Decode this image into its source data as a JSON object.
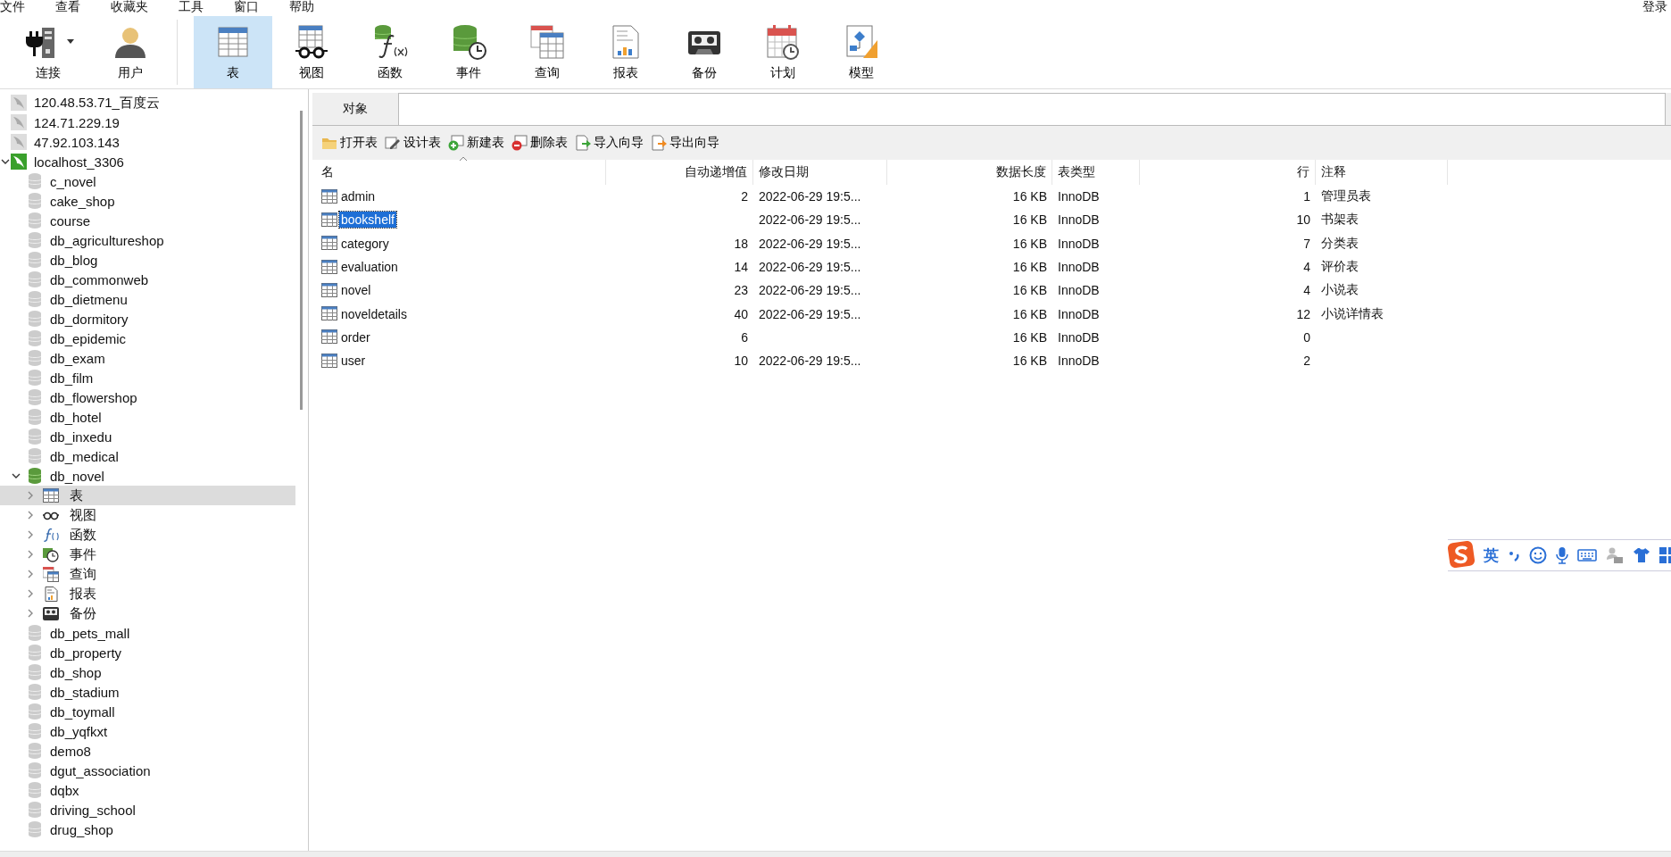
{
  "menu": [
    "文件",
    "查看",
    "收藏夹",
    "工具",
    "窗口",
    "帮助"
  ],
  "account": "登录",
  "toolbar": [
    {
      "label": "连接",
      "selected": false,
      "dropdown": true
    },
    {
      "label": "用户",
      "selected": false
    },
    {
      "label": "表",
      "selected": true
    },
    {
      "label": "视图",
      "selected": false
    },
    {
      "label": "函数",
      "selected": false
    },
    {
      "label": "事件",
      "selected": false
    },
    {
      "label": "查询",
      "selected": false
    },
    {
      "label": "报表",
      "selected": false
    },
    {
      "label": "备份",
      "selected": false
    },
    {
      "label": "计划",
      "selected": false
    },
    {
      "label": "模型",
      "selected": false
    }
  ],
  "sidebar": {
    "items": [
      {
        "name": "120.48.53.71_百度云",
        "kind": "connection",
        "connected": false
      },
      {
        "name": "124.71.229.19",
        "kind": "connection",
        "connected": false
      },
      {
        "name": "47.92.103.143",
        "kind": "connection",
        "connected": false
      },
      {
        "name": "localhost_3306",
        "kind": "connection",
        "connected": true,
        "expanded": true,
        "children": [
          {
            "name": "c_novel",
            "kind": "database",
            "connected": false
          },
          {
            "name": "cake_shop",
            "kind": "database",
            "connected": false
          },
          {
            "name": "course",
            "kind": "database",
            "connected": false
          },
          {
            "name": "db_agricultureshop",
            "kind": "database",
            "connected": false
          },
          {
            "name": "db_blog",
            "kind": "database",
            "connected": false
          },
          {
            "name": "db_commonweb",
            "kind": "database",
            "connected": false
          },
          {
            "name": "db_dietmenu",
            "kind": "database",
            "connected": false
          },
          {
            "name": "db_dormitory",
            "kind": "database",
            "connected": false
          },
          {
            "name": "db_epidemic",
            "kind": "database",
            "connected": false
          },
          {
            "name": "db_exam",
            "kind": "database",
            "connected": false
          },
          {
            "name": "db_film",
            "kind": "database",
            "connected": false
          },
          {
            "name": "db_flowershop",
            "kind": "database",
            "connected": false
          },
          {
            "name": "db_hotel",
            "kind": "database",
            "connected": false
          },
          {
            "name": "db_inxedu",
            "kind": "database",
            "connected": false
          },
          {
            "name": "db_medical",
            "kind": "database",
            "connected": false
          },
          {
            "name": "db_novel",
            "kind": "database",
            "connected": true,
            "expanded": true,
            "children": [
              {
                "name": "表",
                "kind": "table",
                "expanded": false,
                "selected": true
              },
              {
                "name": "视图",
                "kind": "view",
                "expanded": false,
                "selected": false
              },
              {
                "name": "函数",
                "kind": "function",
                "expanded": false,
                "selected": false
              },
              {
                "name": "事件",
                "kind": "event",
                "expanded": false,
                "selected": false
              },
              {
                "name": "查询",
                "kind": "query",
                "expanded": false,
                "selected": false
              },
              {
                "name": "报表",
                "kind": "report",
                "expanded": false,
                "selected": false
              },
              {
                "name": "备份",
                "kind": "backup",
                "expanded": false,
                "selected": false
              }
            ]
          },
          {
            "name": "db_pets_mall",
            "kind": "database",
            "connected": false
          },
          {
            "name": "db_property",
            "kind": "database",
            "connected": false
          },
          {
            "name": "db_shop",
            "kind": "database",
            "connected": false
          },
          {
            "name": "db_stadium",
            "kind": "database",
            "connected": false
          },
          {
            "name": "db_toymall",
            "kind": "database",
            "connected": false
          },
          {
            "name": "db_yqfkxt",
            "kind": "database",
            "connected": false
          },
          {
            "name": "demo8",
            "kind": "database",
            "connected": false
          },
          {
            "name": "dgut_association",
            "kind": "database",
            "connected": false
          },
          {
            "name": "dqbx",
            "kind": "database",
            "connected": false
          },
          {
            "name": "driving_school",
            "kind": "database",
            "connected": false
          },
          {
            "name": "drug_shop",
            "kind": "database",
            "connected": false
          }
        ]
      }
    ]
  },
  "tabs": [
    {
      "label": "对象",
      "selected": true
    }
  ],
  "actions": [
    "打开表",
    "设计表",
    "新建表",
    "删除表",
    "导入向导",
    "导出向导"
  ],
  "table": {
    "columns": [
      "名",
      "自动递增值",
      "修改日期",
      "数据长度",
      "表类型",
      "行",
      "注释"
    ],
    "rows": [
      {
        "selected": false,
        "cells": [
          "admin",
          "2",
          "2022-06-29 19:5...",
          "16 KB",
          "InnoDB",
          "1",
          "管理员表"
        ]
      },
      {
        "selected": true,
        "cells": [
          "bookshelf",
          "",
          "2022-06-29 19:5...",
          "16 KB",
          "InnoDB",
          "10",
          "书架表"
        ]
      },
      {
        "selected": false,
        "cells": [
          "category",
          "18",
          "2022-06-29 19:5...",
          "16 KB",
          "InnoDB",
          "7",
          "分类表"
        ]
      },
      {
        "selected": false,
        "cells": [
          "evaluation",
          "14",
          "2022-06-29 19:5...",
          "16 KB",
          "InnoDB",
          "4",
          "评价表"
        ]
      },
      {
        "selected": false,
        "cells": [
          "novel",
          "23",
          "2022-06-29 19:5...",
          "16 KB",
          "InnoDB",
          "4",
          "小说表"
        ]
      },
      {
        "selected": false,
        "cells": [
          "noveldetails",
          "40",
          "2022-06-29 19:5...",
          "16 KB",
          "InnoDB",
          "12",
          "小说详情表"
        ]
      },
      {
        "selected": false,
        "cells": [
          "order",
          "6",
          "",
          "16 KB",
          "InnoDB",
          "0",
          ""
        ]
      },
      {
        "selected": false,
        "cells": [
          "user",
          "10",
          "2022-06-29 19:5...",
          "16 KB",
          "InnoDB",
          "2",
          ""
        ]
      }
    ]
  },
  "ime": {
    "mode": "英"
  }
}
